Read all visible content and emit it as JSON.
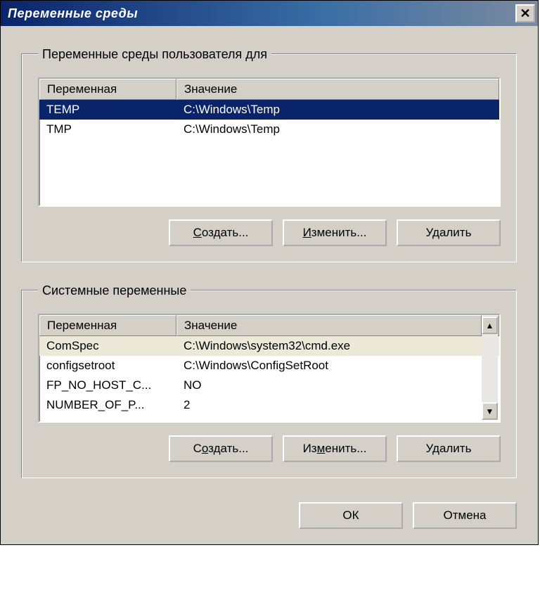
{
  "window": {
    "title": "Переменные среды"
  },
  "userGroup": {
    "legend": "Переменные среды пользователя для",
    "columns": {
      "var": "Переменная",
      "val": "Значение"
    },
    "rows": [
      {
        "var": "TEMP",
        "val": "C:\\Windows\\Temp",
        "selected": true
      },
      {
        "var": "TMP",
        "val": "C:\\Windows\\Temp",
        "selected": false
      }
    ],
    "buttons": {
      "create": "Создать...",
      "edit": "Изменить...",
      "delete": "Удалить"
    }
  },
  "systemGroup": {
    "legend": "Системные переменные",
    "columns": {
      "var": "Переменная",
      "val": "Значение"
    },
    "rows": [
      {
        "var": "ComSpec",
        "val": "C:\\Windows\\system32\\cmd.exe",
        "alt": true
      },
      {
        "var": "configsetroot",
        "val": "C:\\Windows\\ConfigSetRoot",
        "alt": false
      },
      {
        "var": "FP_NO_HOST_C...",
        "val": "NO",
        "alt": false
      },
      {
        "var": "NUMBER_OF_P...",
        "val": "2",
        "alt": false
      }
    ],
    "buttons": {
      "create": "Создать...",
      "edit": "Изменить...",
      "delete": "Удалить"
    }
  },
  "footer": {
    "ok": "ОК",
    "cancel": "Отмена"
  }
}
